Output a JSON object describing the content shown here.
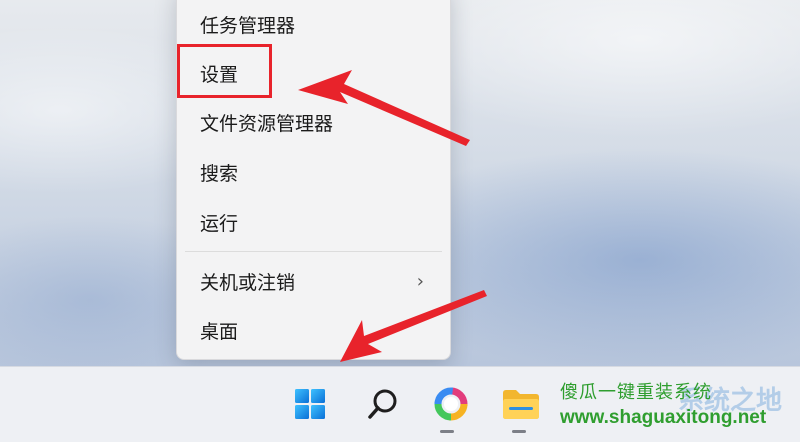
{
  "context_menu": {
    "items": [
      {
        "label": "任务管理器"
      },
      {
        "label": "设置"
      },
      {
        "label": "文件资源管理器"
      },
      {
        "label": "搜索"
      },
      {
        "label": "运行"
      },
      {
        "label": "关机或注销",
        "submenu_icon": "chevron-right-icon"
      },
      {
        "label": "桌面"
      }
    ],
    "highlighted_item": "设置"
  },
  "taskbar": {
    "buttons": [
      {
        "name": "start-button",
        "icon": "windows-logo-icon",
        "highlighted": true
      },
      {
        "name": "search-button",
        "icon": "search-icon"
      },
      {
        "name": "copilot-button",
        "icon": "colorful-ring-icon"
      },
      {
        "name": "file-explorer-button",
        "icon": "folder-icon"
      }
    ]
  },
  "watermark": {
    "title": "傻瓜一键重装系统",
    "url": "www.shaguaxitong.net",
    "ghost_text": "系统之地"
  },
  "colors": {
    "annotation_red": "#e8232b",
    "watermark_green": "#2f9e2f",
    "windows_blue": "#1c8fe0"
  }
}
